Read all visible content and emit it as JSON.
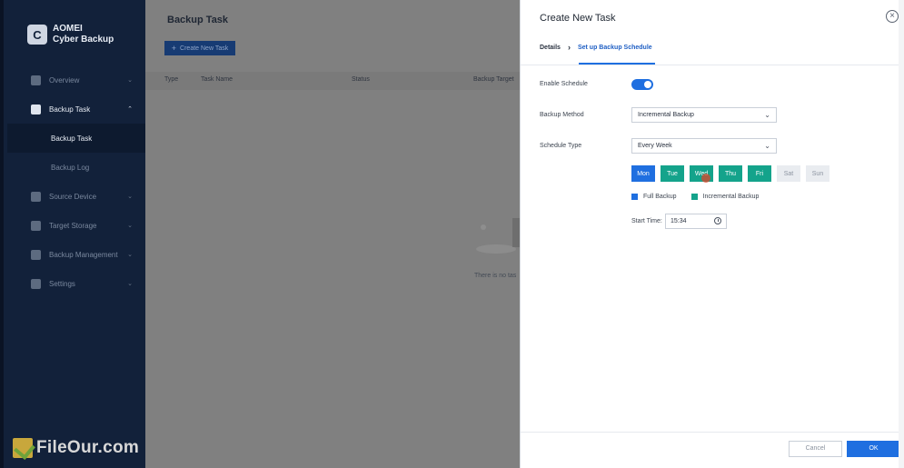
{
  "app": {
    "logo_line1": "AOMEI",
    "logo_line2": "Cyber Backup",
    "logo_mark": "C"
  },
  "sidebar": {
    "items": [
      {
        "label": "Overview",
        "icon": "overview-icon"
      },
      {
        "label": "Backup Task",
        "icon": "clipboard-icon"
      },
      {
        "label": "Backup Task"
      },
      {
        "label": "Backup Log"
      },
      {
        "label": "Source Device",
        "icon": "monitor-icon"
      },
      {
        "label": "Target Storage",
        "icon": "location-pin-icon"
      },
      {
        "label": "Backup Management",
        "icon": "layers-icon"
      },
      {
        "label": "Settings",
        "icon": "gear-icon"
      }
    ]
  },
  "main": {
    "title": "Backup Task",
    "create_button": "Create New Task",
    "columns": [
      "Type",
      "Task Name",
      "Status",
      "Backup Target"
    ],
    "empty_text": "There is no tas"
  },
  "panel": {
    "title": "Create New Task",
    "steps": [
      "Details",
      "Set up Backup Schedule"
    ],
    "enable_schedule_label": "Enable Schedule",
    "enable_schedule_on": true,
    "backup_method_label": "Backup Method",
    "backup_method_value": "Incremental Backup",
    "schedule_type_label": "Schedule Type",
    "schedule_type_value": "Every Week",
    "days": [
      {
        "label": "Mon",
        "state": "full"
      },
      {
        "label": "Tue",
        "state": "incremental"
      },
      {
        "label": "Wed",
        "state": "incremental"
      },
      {
        "label": "Thu",
        "state": "incremental"
      },
      {
        "label": "Fri",
        "state": "incremental"
      },
      {
        "label": "Sat",
        "state": "off"
      },
      {
        "label": "Sun",
        "state": "off"
      }
    ],
    "legend_full": "Full Backup",
    "legend_incremental": "Incremental Backup",
    "start_time_label": "Start Time:",
    "start_time_value": "15:34",
    "cancel_label": "Cancel",
    "ok_label": "OK"
  },
  "watermark": "FileOur.com",
  "colors": {
    "accent": "#1f6fe0",
    "incremental": "#14a38b",
    "sidebar_bg": "#12213a"
  }
}
